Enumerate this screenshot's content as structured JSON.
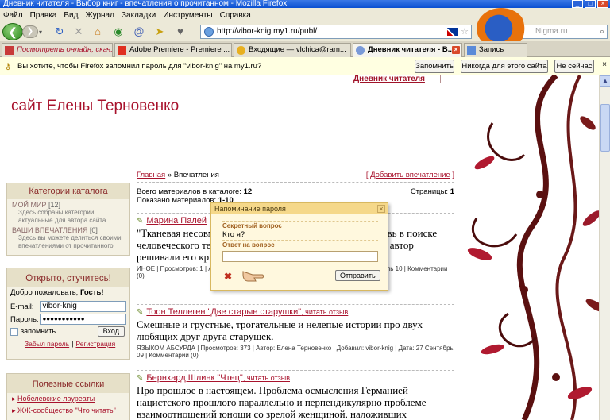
{
  "window": {
    "title": "Дневник читателя - Выбор книг - впечатления о прочитанном - Mozilla Firefox"
  },
  "menu": {
    "items": [
      "Файл",
      "Правка",
      "Вид",
      "Журнал",
      "Закладки",
      "Инструменты",
      "Справка"
    ]
  },
  "navbar": {
    "url": "http://vibor-knig.my1.ru/publ/",
    "search_placeholder": "Nigma.ru"
  },
  "tabs": [
    {
      "label": "Посмотреть онлайн, скач...",
      "active": false
    },
    {
      "label": "Adobe Premiere - Premiere ...",
      "active": false
    },
    {
      "label": "Входящие — vlchica@ram...",
      "active": false
    },
    {
      "label": "Дневник читателя - В...",
      "active": true
    },
    {
      "label": "Запись",
      "active": false
    }
  ],
  "notification": {
    "message": "Вы хотите, чтобы Firefox запомнил пароль для \"vibor-knig\" на my1.ru?",
    "remember": "Запомнить",
    "never": "Никогда для этого сайта",
    "not_now": "Не сейчас"
  },
  "site": {
    "top_link": "Дневник читателя",
    "title": "сайт Елены Терновенко"
  },
  "categories": {
    "heading": "Категории каталога",
    "items": [
      {
        "name": "МОЙ МИР",
        "count": "[12]",
        "desc": "Здесь собраны категории, актуальные для автора сайта."
      },
      {
        "name": "ВАШИ ВПЕЧАТЛЕНИЯ",
        "count": "[0]",
        "desc": "Здесь вы можете делиться своими впечатлениями от прочитанного"
      }
    ]
  },
  "login": {
    "heading": "Открыто, стучитесь!",
    "welcome": "Добро пожаловать,",
    "guest": "Гость!",
    "email_label": "E-mail:",
    "email_value": "vibor-knig",
    "password_label": "Пароль:",
    "password_value": "●●●●●●●●●●●",
    "remember_label": "запомнить",
    "submit": "Вход",
    "forgot": "Забыл пароль",
    "sep": "|",
    "register": "Регистрация"
  },
  "links": {
    "heading": "Полезные ссылки",
    "items": [
      "Нобелевские лауреаты",
      "ЖЖ-сообщество \"Что читать\""
    ]
  },
  "main": {
    "crumb_home": "Главная",
    "crumb_sep": "»",
    "crumb_current": "Впечатления",
    "add_open": "[",
    "add_link": "Добавить впечатление",
    "add_close": "]",
    "total_label": "Всего материалов в каталоге:",
    "total_value": "12",
    "shown_label": "Показано материалов:",
    "shown_value": "1-10",
    "pages_label": "Страницы:",
    "pages_value": "1"
  },
  "entries": [
    {
      "title": "Марина Палей",
      "read": "",
      "text": "\"Тканевая несовместимость\" - история о секретная любовь в поиске человеческого тепла, чужого существования ... в которой автор решивали его критики.",
      "meta": "ИНОЕ | Просмотров: 1 | Автор: Елена Терновенко | Добавил: vibor-knig | Дата: 31 Июль 10 | Комментарии (0)"
    },
    {
      "title": "Тоон Теллеген \"Две старые старушки\"",
      "read": ", читать отзыв",
      "text": "Смешные и грустные, трогательные и нелепые истории про двух любящих друг друга старушек.",
      "meta": "ЯЗЫКОМ АБСУРДА | Просмотров: 373 | Автор: Елена Терновенко | Добавил: vibor-knig | Дата: 27 Сентябрь 09 | Комментарии (0)"
    },
    {
      "title": "Бернхард Шлинк \"Чтец\"",
      "read": ", читать отзыв",
      "text": "Про  прошлое в настоящем. Проблема осмысления Германией нацистского прошлого параллельно и перпендикулярно проблеме взаимоотношений юноши со зрелой женщиной, наложивших",
      "meta": ""
    }
  ],
  "popup": {
    "title": "Напоминание пароля",
    "question_label": "Секретный вопрос",
    "question_value": "Кто я?",
    "answer_label": "Ответ на вопрос",
    "answer_value": "",
    "send": "Отправить"
  },
  "colors": {
    "accent": "#a8122c",
    "link_green": "#6a8a2a",
    "popup_bg": "#fff8de"
  }
}
